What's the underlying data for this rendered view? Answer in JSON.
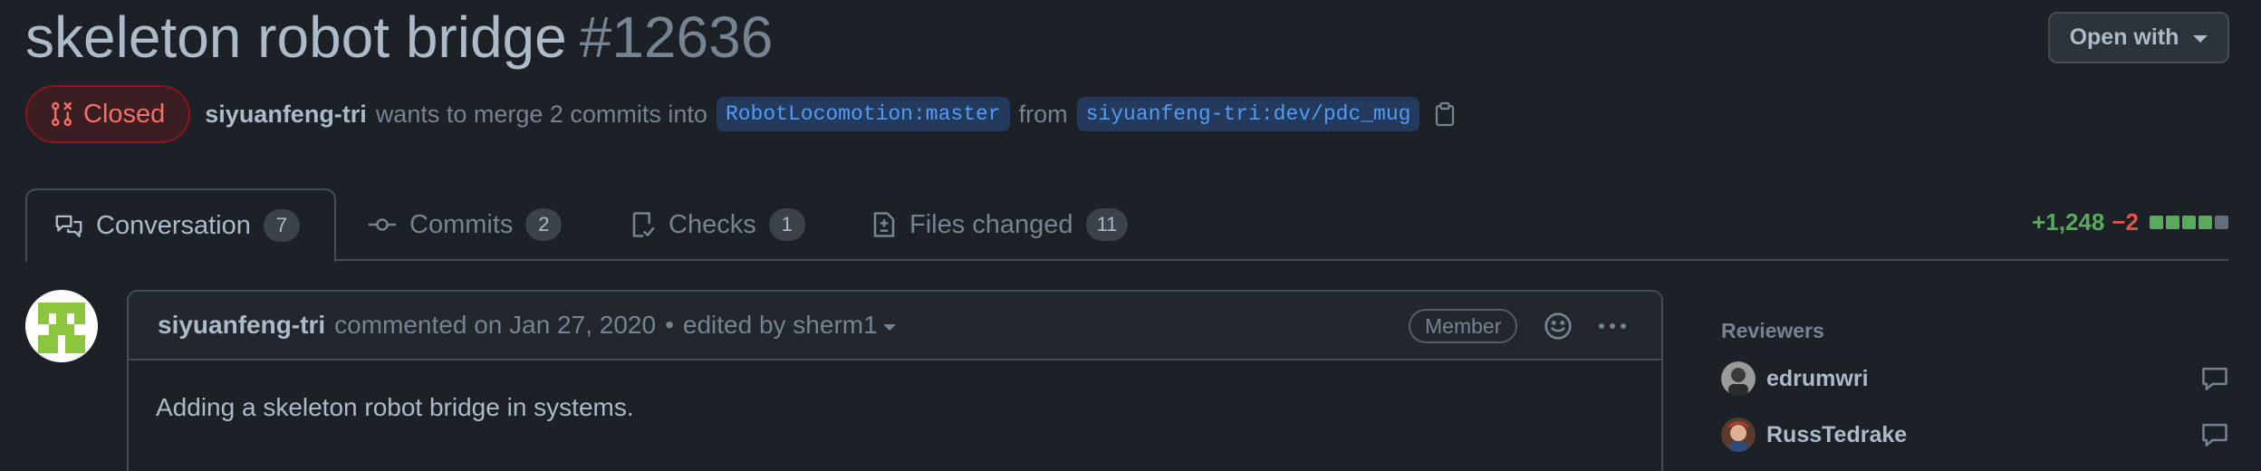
{
  "pr": {
    "title": "skeleton robot bridge",
    "number": "#12636",
    "open_with_label": "Open with",
    "state": "Closed",
    "author": "siyuanfeng-tri",
    "merge_text": "wants to merge 2 commits into",
    "base_branch": "RobotLocomotion:master",
    "from_text": "from",
    "head_branch": "siyuanfeng-tri:dev/pdc_mug"
  },
  "tabs": [
    {
      "label": "Conversation",
      "count": "7",
      "icon": "comment-discussion-icon"
    },
    {
      "label": "Commits",
      "count": "2",
      "icon": "git-commit-icon"
    },
    {
      "label": "Checks",
      "count": "1",
      "icon": "checklist-icon"
    },
    {
      "label": "Files changed",
      "count": "11",
      "icon": "file-diff-icon"
    }
  ],
  "diffstat": {
    "additions": "+1,248",
    "deletions": "−2",
    "colors": {
      "add": "#57ab5a",
      "neutral": "#636e7b"
    }
  },
  "comment": {
    "author": "siyuanfeng-tri",
    "action": "commented on Jan 27, 2020",
    "separator": "•",
    "edited": "edited by sherm1",
    "role": "Member",
    "body": "Adding a skeleton robot bridge in systems."
  },
  "sidebar": {
    "heading": "Reviewers",
    "reviewers": [
      {
        "name": "edrumwri",
        "icon": "comment-icon"
      },
      {
        "name": "RussTedrake",
        "icon": "comment-icon"
      }
    ]
  },
  "colors": {
    "background": "#1c2128",
    "closed": "#f47067",
    "link": "#539bf5"
  }
}
